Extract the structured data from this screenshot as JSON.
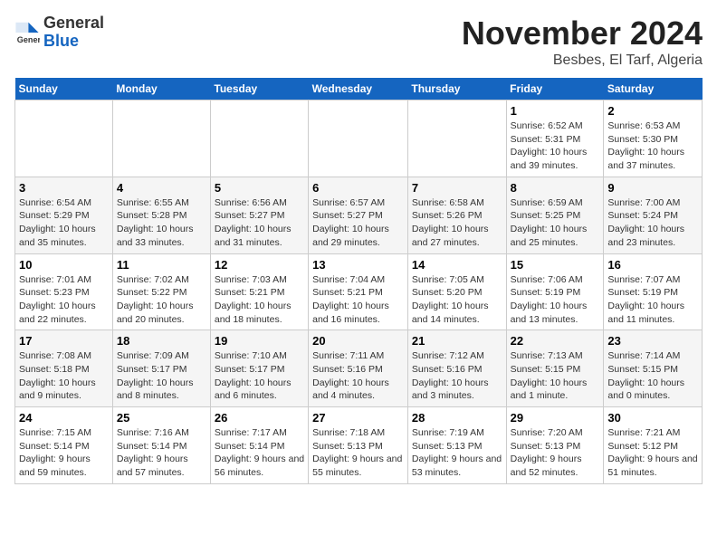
{
  "logo": {
    "general": "General",
    "blue": "Blue"
  },
  "title": "November 2024",
  "subtitle": "Besbes, El Tarf, Algeria",
  "days_of_week": [
    "Sunday",
    "Monday",
    "Tuesday",
    "Wednesday",
    "Thursday",
    "Friday",
    "Saturday"
  ],
  "weeks": [
    [
      {
        "day": "",
        "info": ""
      },
      {
        "day": "",
        "info": ""
      },
      {
        "day": "",
        "info": ""
      },
      {
        "day": "",
        "info": ""
      },
      {
        "day": "",
        "info": ""
      },
      {
        "day": "1",
        "info": "Sunrise: 6:52 AM\nSunset: 5:31 PM\nDaylight: 10 hours and 39 minutes."
      },
      {
        "day": "2",
        "info": "Sunrise: 6:53 AM\nSunset: 5:30 PM\nDaylight: 10 hours and 37 minutes."
      }
    ],
    [
      {
        "day": "3",
        "info": "Sunrise: 6:54 AM\nSunset: 5:29 PM\nDaylight: 10 hours and 35 minutes."
      },
      {
        "day": "4",
        "info": "Sunrise: 6:55 AM\nSunset: 5:28 PM\nDaylight: 10 hours and 33 minutes."
      },
      {
        "day": "5",
        "info": "Sunrise: 6:56 AM\nSunset: 5:27 PM\nDaylight: 10 hours and 31 minutes."
      },
      {
        "day": "6",
        "info": "Sunrise: 6:57 AM\nSunset: 5:27 PM\nDaylight: 10 hours and 29 minutes."
      },
      {
        "day": "7",
        "info": "Sunrise: 6:58 AM\nSunset: 5:26 PM\nDaylight: 10 hours and 27 minutes."
      },
      {
        "day": "8",
        "info": "Sunrise: 6:59 AM\nSunset: 5:25 PM\nDaylight: 10 hours and 25 minutes."
      },
      {
        "day": "9",
        "info": "Sunrise: 7:00 AM\nSunset: 5:24 PM\nDaylight: 10 hours and 23 minutes."
      }
    ],
    [
      {
        "day": "10",
        "info": "Sunrise: 7:01 AM\nSunset: 5:23 PM\nDaylight: 10 hours and 22 minutes."
      },
      {
        "day": "11",
        "info": "Sunrise: 7:02 AM\nSunset: 5:22 PM\nDaylight: 10 hours and 20 minutes."
      },
      {
        "day": "12",
        "info": "Sunrise: 7:03 AM\nSunset: 5:21 PM\nDaylight: 10 hours and 18 minutes."
      },
      {
        "day": "13",
        "info": "Sunrise: 7:04 AM\nSunset: 5:21 PM\nDaylight: 10 hours and 16 minutes."
      },
      {
        "day": "14",
        "info": "Sunrise: 7:05 AM\nSunset: 5:20 PM\nDaylight: 10 hours and 14 minutes."
      },
      {
        "day": "15",
        "info": "Sunrise: 7:06 AM\nSunset: 5:19 PM\nDaylight: 10 hours and 13 minutes."
      },
      {
        "day": "16",
        "info": "Sunrise: 7:07 AM\nSunset: 5:19 PM\nDaylight: 10 hours and 11 minutes."
      }
    ],
    [
      {
        "day": "17",
        "info": "Sunrise: 7:08 AM\nSunset: 5:18 PM\nDaylight: 10 hours and 9 minutes."
      },
      {
        "day": "18",
        "info": "Sunrise: 7:09 AM\nSunset: 5:17 PM\nDaylight: 10 hours and 8 minutes."
      },
      {
        "day": "19",
        "info": "Sunrise: 7:10 AM\nSunset: 5:17 PM\nDaylight: 10 hours and 6 minutes."
      },
      {
        "day": "20",
        "info": "Sunrise: 7:11 AM\nSunset: 5:16 PM\nDaylight: 10 hours and 4 minutes."
      },
      {
        "day": "21",
        "info": "Sunrise: 7:12 AM\nSunset: 5:16 PM\nDaylight: 10 hours and 3 minutes."
      },
      {
        "day": "22",
        "info": "Sunrise: 7:13 AM\nSunset: 5:15 PM\nDaylight: 10 hours and 1 minute."
      },
      {
        "day": "23",
        "info": "Sunrise: 7:14 AM\nSunset: 5:15 PM\nDaylight: 10 hours and 0 minutes."
      }
    ],
    [
      {
        "day": "24",
        "info": "Sunrise: 7:15 AM\nSunset: 5:14 PM\nDaylight: 9 hours and 59 minutes."
      },
      {
        "day": "25",
        "info": "Sunrise: 7:16 AM\nSunset: 5:14 PM\nDaylight: 9 hours and 57 minutes."
      },
      {
        "day": "26",
        "info": "Sunrise: 7:17 AM\nSunset: 5:14 PM\nDaylight: 9 hours and 56 minutes."
      },
      {
        "day": "27",
        "info": "Sunrise: 7:18 AM\nSunset: 5:13 PM\nDaylight: 9 hours and 55 minutes."
      },
      {
        "day": "28",
        "info": "Sunrise: 7:19 AM\nSunset: 5:13 PM\nDaylight: 9 hours and 53 minutes."
      },
      {
        "day": "29",
        "info": "Sunrise: 7:20 AM\nSunset: 5:13 PM\nDaylight: 9 hours and 52 minutes."
      },
      {
        "day": "30",
        "info": "Sunrise: 7:21 AM\nSunset: 5:12 PM\nDaylight: 9 hours and 51 minutes."
      }
    ]
  ]
}
